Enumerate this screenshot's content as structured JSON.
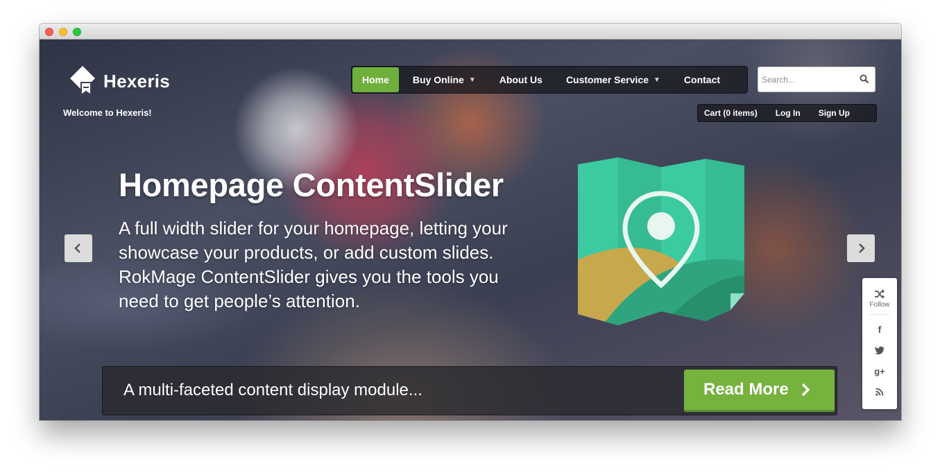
{
  "brand": {
    "name": "Hexeris",
    "welcome": "Welcome to Hexeris!"
  },
  "nav": {
    "items": [
      {
        "label": "Home",
        "active": true,
        "has_dropdown": false
      },
      {
        "label": "Buy Online",
        "active": false,
        "has_dropdown": true
      },
      {
        "label": "About Us",
        "active": false,
        "has_dropdown": false
      },
      {
        "label": "Customer Service",
        "active": false,
        "has_dropdown": true
      },
      {
        "label": "Contact",
        "active": false,
        "has_dropdown": false
      }
    ]
  },
  "search": {
    "placeholder": "Search...",
    "value": "",
    "icon": "search-icon"
  },
  "user_links": {
    "cart": "Cart (0 items)",
    "login": "Log In",
    "signup": "Sign Up"
  },
  "slide": {
    "title": "Homepage ContentSlider",
    "description": "A full width slider for your homepage, letting your showcase your products, or add custom slides. RokMage ContentSlider gives you the tools you need to get people’s attention.",
    "caption": "A multi-faceted content display module...",
    "cta_label": "Read More",
    "prev_icon": "chevron-left-icon",
    "next_icon": "chevron-right-icon"
  },
  "social": {
    "follow_label": "Follow",
    "icons": [
      "shuffle-icon",
      "facebook-icon",
      "twitter-icon",
      "google-plus-icon",
      "rss-icon"
    ],
    "glyphs": {
      "facebook": "f",
      "google": "g+"
    }
  },
  "colors": {
    "accent_green": "#6faf3c",
    "map_teal": "#3cc9a0",
    "map_sand": "#c8a94e"
  }
}
